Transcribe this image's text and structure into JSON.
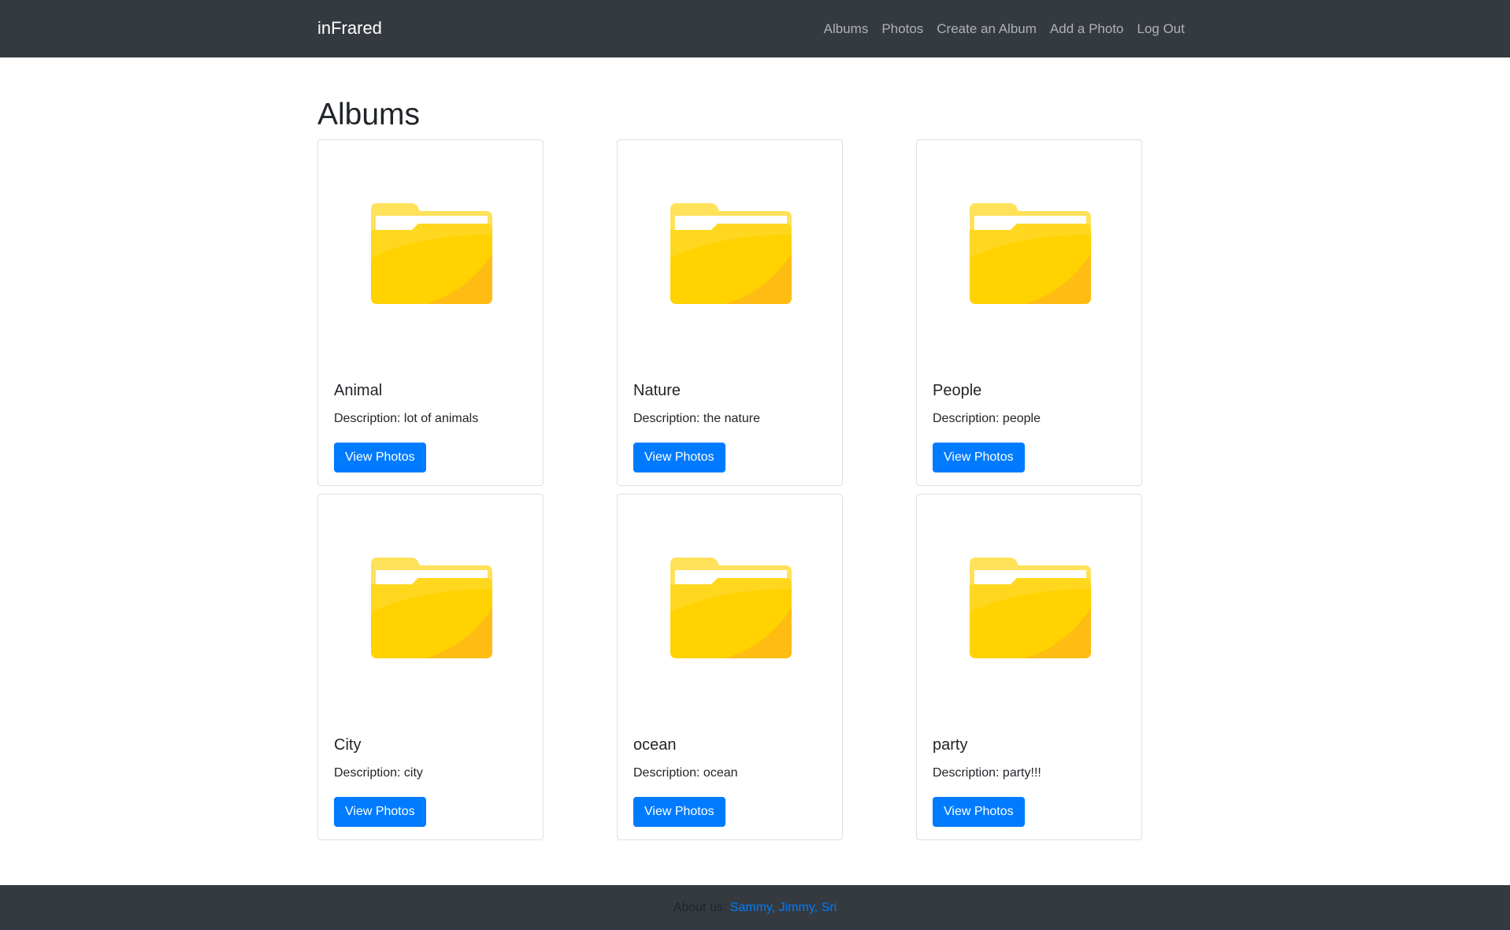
{
  "navbar": {
    "brand": "inFrared",
    "links": [
      {
        "label": "Albums"
      },
      {
        "label": "Photos"
      },
      {
        "label": "Create an Album"
      },
      {
        "label": "Add a Photo"
      },
      {
        "label": "Log Out"
      }
    ]
  },
  "main": {
    "title": "Albums",
    "description_prefix": "Description: ",
    "view_button_label": "View Photos",
    "folder_icon": "folder-icon",
    "albums": [
      {
        "name": "Animal",
        "description": "lot of animals"
      },
      {
        "name": "Nature",
        "description": "the nature"
      },
      {
        "name": "People",
        "description": "people"
      },
      {
        "name": "City",
        "description": "city"
      },
      {
        "name": "ocean",
        "description": "ocean"
      },
      {
        "name": "party",
        "description": "party!!!"
      }
    ]
  },
  "footer": {
    "label": "About us: ",
    "link": "Sammy, Jimmy, Sri"
  },
  "colors": {
    "navbar_bg": "#343a40",
    "primary": "#007bff",
    "folder_yellow": "#ffd200",
    "folder_shadow": "#ffbc12"
  }
}
